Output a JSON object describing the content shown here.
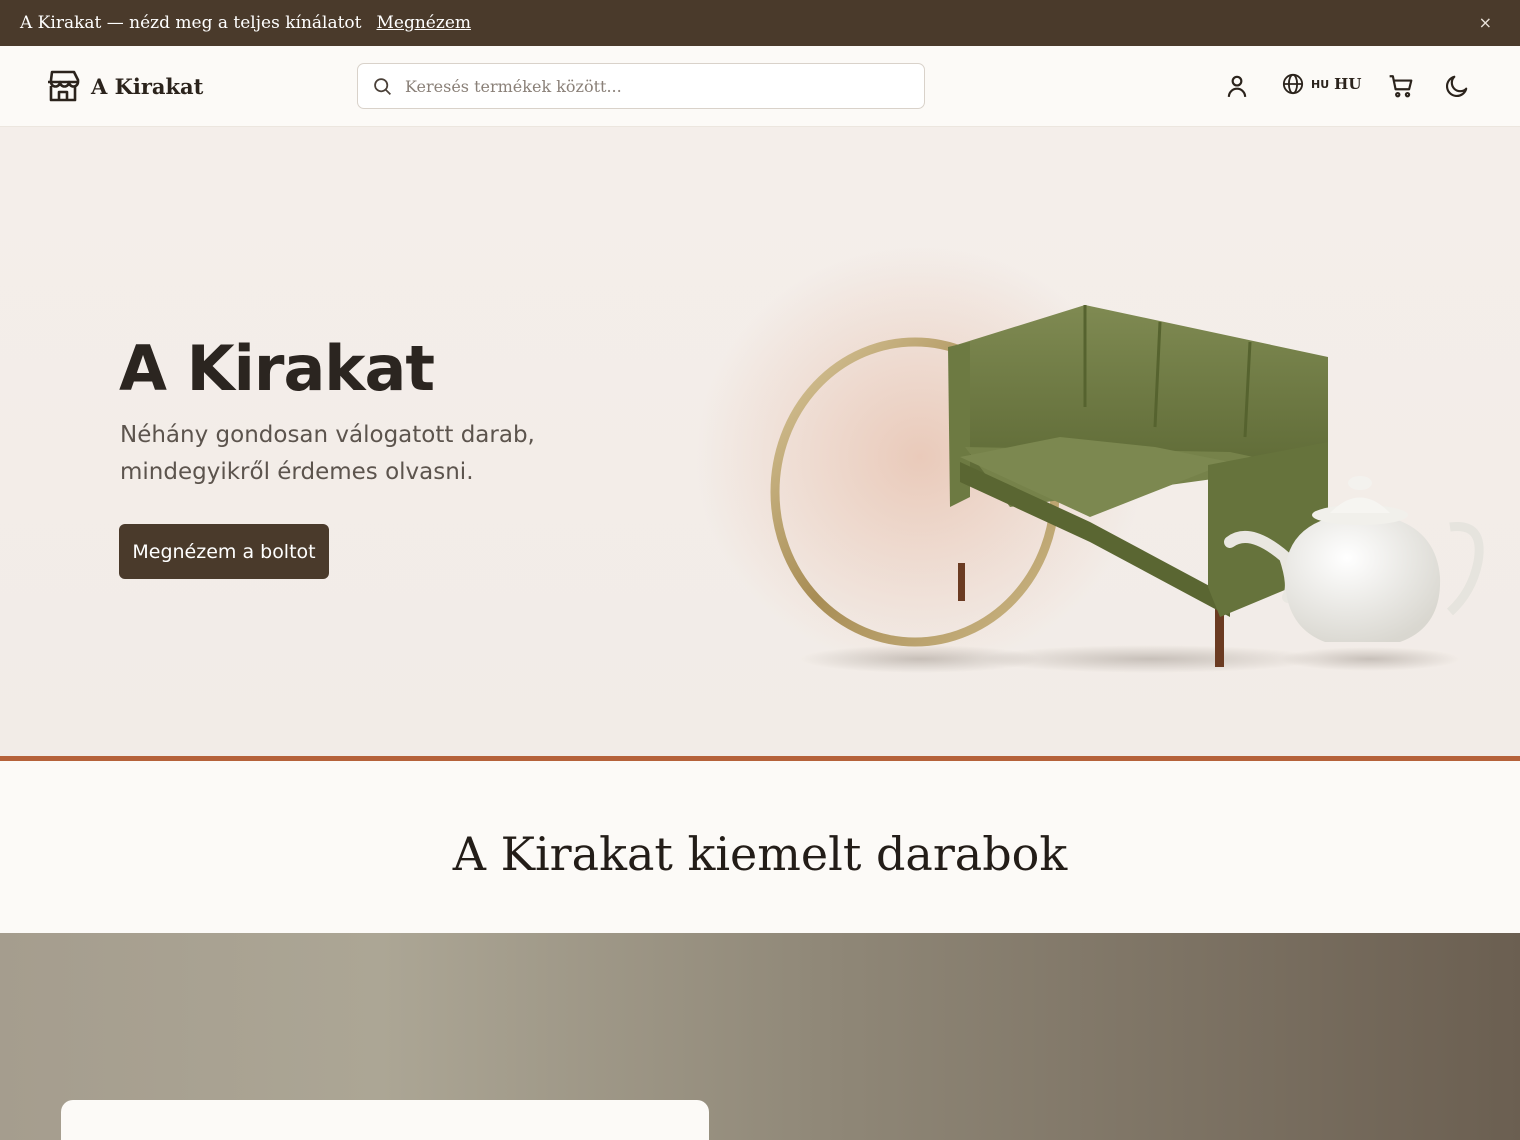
{
  "announcement": {
    "message": "A Kirakat — nézd meg a teljes kínálatot",
    "link": "Megnézem",
    "close_icon": "×"
  },
  "header": {
    "brand": "A Kirakat",
    "search_placeholder": "Keresés termékek között...",
    "lang_small": "HU",
    "lang_big": "HU",
    "icons": [
      "store-icon",
      "search-icon",
      "user-icon",
      "globe-icon",
      "cart-icon",
      "moon-icon"
    ]
  },
  "hero": {
    "title": "A Kirakat",
    "subtitle": "Néhány gondosan válogatott darab, mindegyikről érdemes olvasni.",
    "cta": "Megnézem a boltot"
  },
  "featured": {
    "title": "A Kirakat kiemelt darabok"
  },
  "colors": {
    "announcement_bg": "#4a3a2b",
    "accent_line": "#b5623a",
    "button_bg": "#4a3a2b",
    "page_bg": "#fcfaf7"
  }
}
